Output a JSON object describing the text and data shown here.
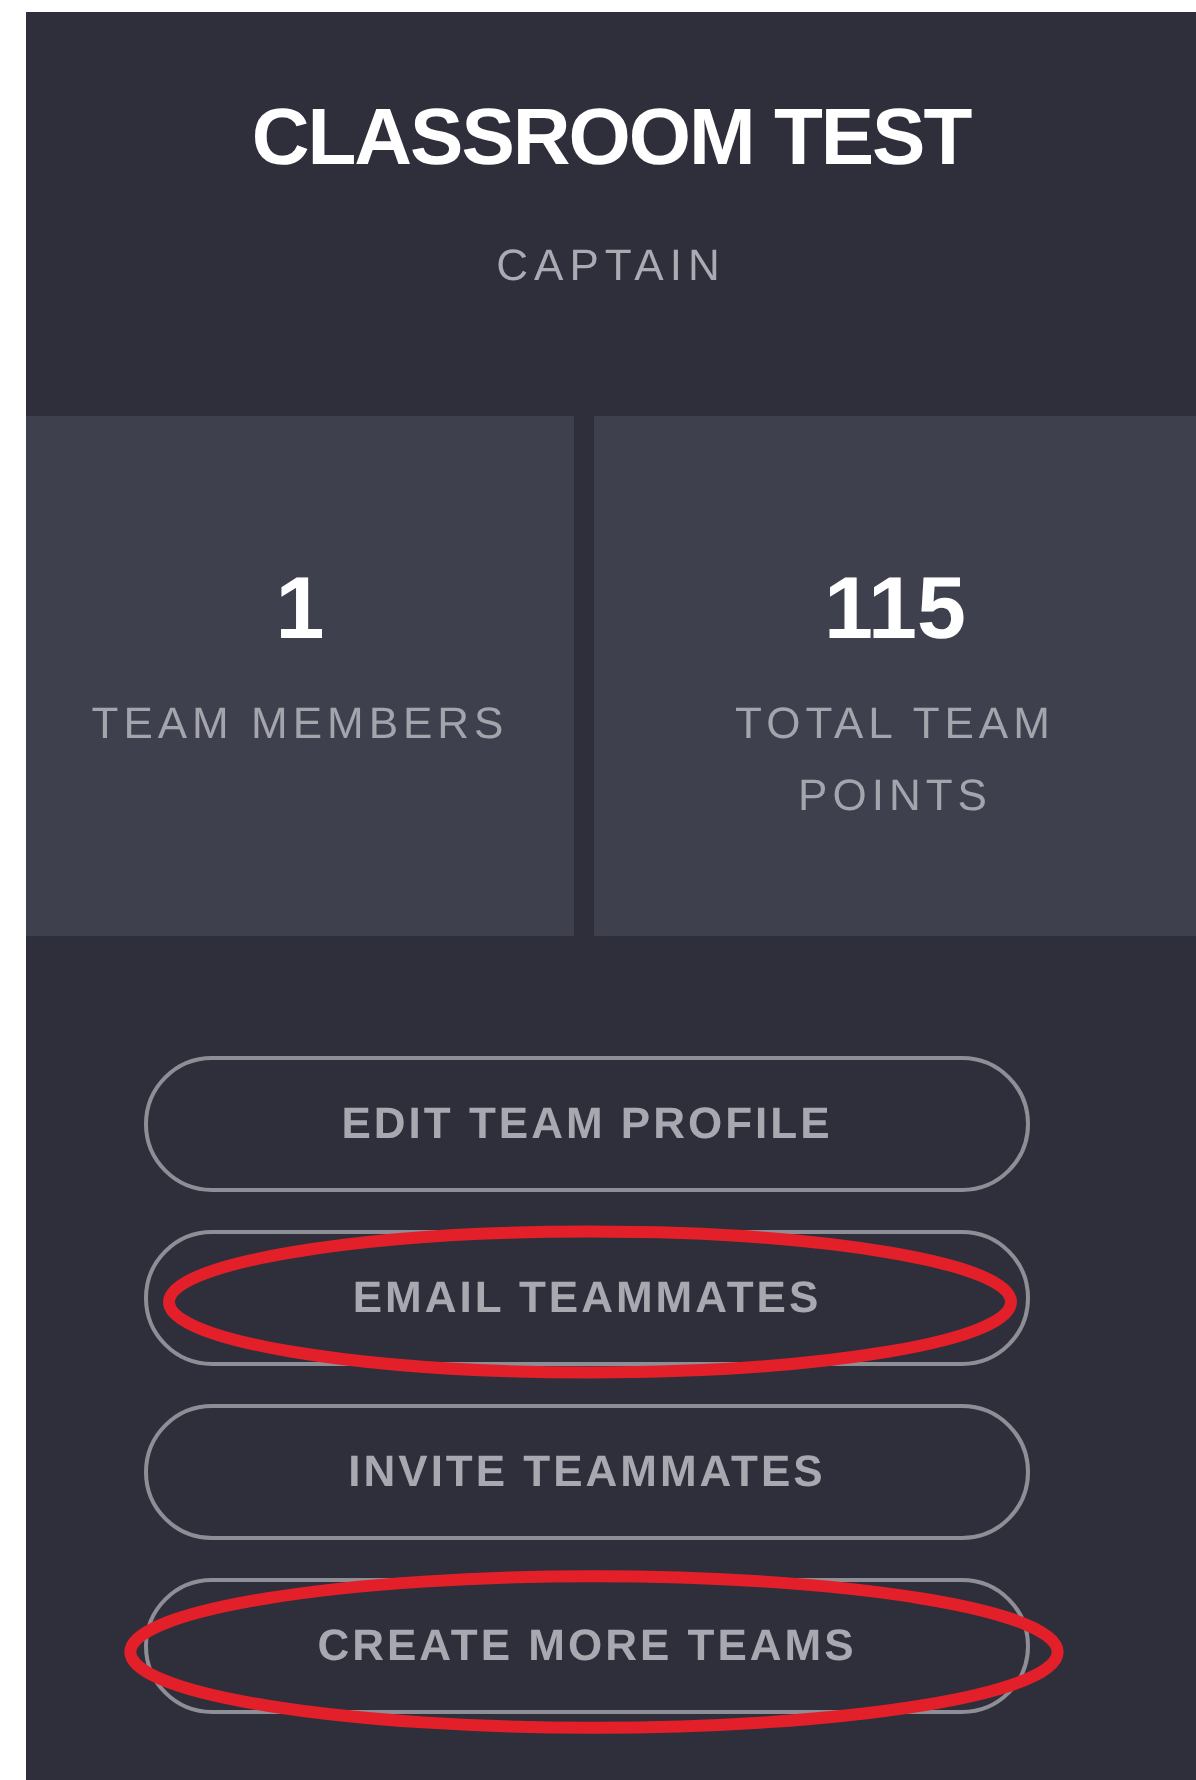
{
  "team": {
    "name": "CLASSROOM TEST",
    "role": "CAPTAIN"
  },
  "stats": [
    {
      "value": "1",
      "label": "TEAM MEMBERS"
    },
    {
      "value": "115",
      "label": "TOTAL TEAM POINTS"
    }
  ],
  "buttons": [
    {
      "label": "EDIT TEAM PROFILE",
      "circled": false
    },
    {
      "label": "EMAIL TEAMMATES",
      "circled": true
    },
    {
      "label": "INVITE TEAMMATES",
      "circled": false
    },
    {
      "label": "CREATE MORE TEAMS",
      "circled": true
    }
  ]
}
